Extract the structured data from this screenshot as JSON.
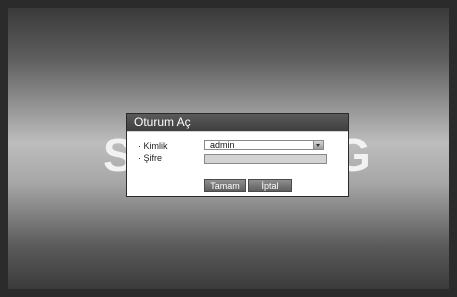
{
  "background": {
    "brand_left": "S",
    "brand_right": "G"
  },
  "login_dialog": {
    "title": "Oturum Aç",
    "id_label": "· Kimlik",
    "id_value": "admin",
    "password_label": "· Şifre",
    "password_value": "",
    "ok_label": "Tamam",
    "cancel_label": "İptal"
  },
  "colors": {
    "title_bar": "#4a4a4a",
    "button": "#707070",
    "password_field": "#d3d3d3"
  }
}
